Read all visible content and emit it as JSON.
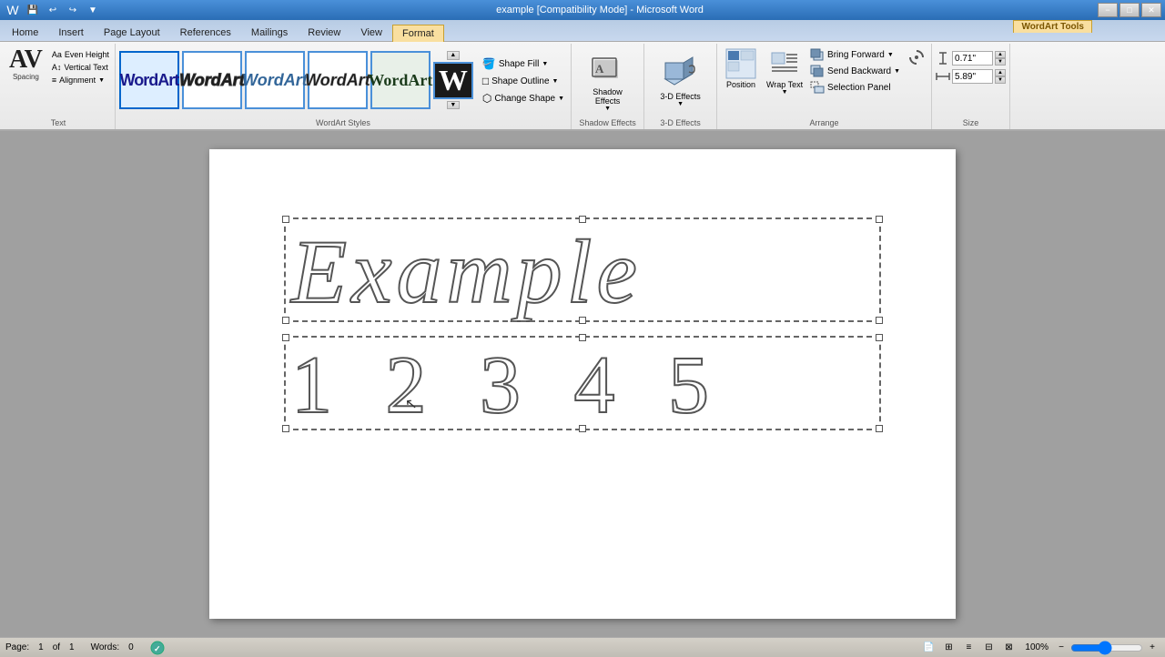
{
  "titlebar": {
    "text": "example [Compatibility Mode] - Microsoft Word",
    "minimize": "−",
    "restore": "□",
    "close": "✕"
  },
  "quickaccess": {
    "save": "💾",
    "undo": "↩",
    "redo": "↪",
    "customize": "▼"
  },
  "tabs": [
    {
      "label": "Home",
      "active": false
    },
    {
      "label": "Insert",
      "active": false
    },
    {
      "label": "Page Layout",
      "active": false
    },
    {
      "label": "References",
      "active": false
    },
    {
      "label": "Mailings",
      "active": false
    },
    {
      "label": "Review",
      "active": false
    },
    {
      "label": "View",
      "active": false
    },
    {
      "label": "Format",
      "active": true,
      "wordart": true
    }
  ],
  "wordart_tools_label": "WordArt Tools",
  "ribbon": {
    "text_group": {
      "label": "Text",
      "av_label": "AV",
      "spacing_label": "Spacing",
      "even_height": "Even Height",
      "vertical_text": "Vertical Text",
      "alignment": "Alignment"
    },
    "wordart_styles_group": {
      "label": "WordArt Styles",
      "samples": [
        {
          "text": "WordArt",
          "style": 1
        },
        {
          "text": "WordArt",
          "style": 2
        },
        {
          "text": "WordArt",
          "style": 3
        },
        {
          "text": "WordArt",
          "style": 4
        },
        {
          "text": "WordArt",
          "style": 5
        }
      ],
      "shape_fill": "Shape Fill",
      "shape_outline": "Shape Outline",
      "change_shape": "Change Shape"
    },
    "shadow_effects_group": {
      "label": "Shadow Effects",
      "button_label": "Shadow Effects"
    },
    "three_d_group": {
      "label": "3-D Effects",
      "button_label": "3-D Effects"
    },
    "arrange_group": {
      "label": "Arrange",
      "bring_forward": "Bring Forward",
      "send_backward": "Send Backward",
      "position": "Position",
      "wrap_text": "Wrap Text",
      "selection_panel": "Selection Panel",
      "rotate": "Rotate"
    },
    "size_group": {
      "label": "Size",
      "height_value": "0.71\"",
      "width_value": "5.89\""
    }
  },
  "page": {
    "wordart_text": "Example",
    "wordart_numbers": "1 2 3 4 5"
  },
  "statusbar": {
    "page": "Page:",
    "page_num": "1",
    "of": "of",
    "total": "1",
    "words": "Words:",
    "word_count": "0",
    "zoom": "100%",
    "zoom_level": 100
  }
}
